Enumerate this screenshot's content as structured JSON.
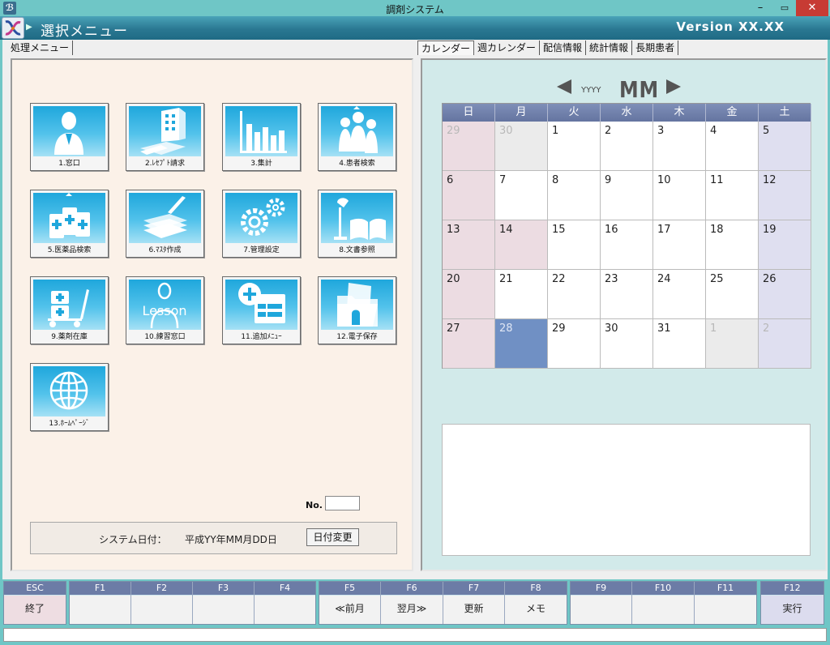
{
  "window": {
    "title": "調剤システム",
    "minimize": "–",
    "maximize": "▭",
    "close": "✕"
  },
  "header": {
    "title": "選択メニュー",
    "version": "Version  XX.XX"
  },
  "left_tabs": [
    {
      "label": "処理メニュー"
    }
  ],
  "right_tabs": [
    {
      "label": "カレンダー"
    },
    {
      "label": "週カレンダー"
    },
    {
      "label": "配信情報"
    },
    {
      "label": "統計情報"
    },
    {
      "label": "長期患者"
    }
  ],
  "menu": [
    {
      "label": "1.窓口",
      "icon": "receptionist-icon"
    },
    {
      "label": "2.ﾚｾﾌﾟﾄ請求",
      "icon": "building-billing-icon"
    },
    {
      "label": "3.集計",
      "icon": "bar-chart-icon"
    },
    {
      "label": "4.患者検索",
      "icon": "people-search-icon"
    },
    {
      "label": "5.医薬品検索",
      "icon": "medicine-search-icon"
    },
    {
      "label": "6.ﾏｽﾀ作成",
      "icon": "documents-pen-icon"
    },
    {
      "label": "7.管理設定",
      "icon": "gears-icon"
    },
    {
      "label": "8.文書参照",
      "icon": "lamp-book-icon"
    },
    {
      "label": "9.薬剤在庫",
      "icon": "medicine-cart-icon"
    },
    {
      "label": "10.練習窓口",
      "icon": "lesson-icon"
    },
    {
      "label": "11.追加ﾒﾆｭｰ",
      "icon": "add-menu-icon"
    },
    {
      "label": "12.電子保存",
      "icon": "folder-icon"
    },
    {
      "label": "13.ﾎｰﾑﾍﾟｰｼﾞ",
      "icon": "globe-icon"
    }
  ],
  "no_field": {
    "label": "No.",
    "value": ""
  },
  "system_date": {
    "label": "システム日付：",
    "value": "平成YY年MM月DD日",
    "button": "日付変更"
  },
  "calendar": {
    "year": "YYYY",
    "month": "MM",
    "weekdays": [
      "日",
      "月",
      "火",
      "水",
      "木",
      "金",
      "土"
    ],
    "weeks": [
      [
        "29",
        "30",
        "1",
        "2",
        "3",
        "4",
        "5"
      ],
      [
        "6",
        "7",
        "8",
        "9",
        "10",
        "11",
        "12"
      ],
      [
        "13",
        "14",
        "15",
        "16",
        "17",
        "18",
        "19"
      ],
      [
        "20",
        "21",
        "22",
        "23",
        "24",
        "25",
        "26"
      ],
      [
        "27",
        "28",
        "29",
        "30",
        "31",
        "1",
        "2"
      ]
    ],
    "other_month_cells": [
      [
        0,
        0
      ],
      [
        0,
        1
      ],
      [
        4,
        5
      ],
      [
        4,
        6
      ]
    ],
    "holiday_cells": [
      [
        2,
        1
      ]
    ],
    "selected_cell": [
      4,
      1
    ],
    "colors": {
      "sunday": "#ecdce2",
      "saturday": "#dfdff0",
      "selected": "#7090c4",
      "header": "#6c7ca6"
    }
  },
  "fkeys": {
    "esc": {
      "code": "ESC",
      "label": "終了"
    },
    "f1": {
      "code": "F1",
      "label": ""
    },
    "f2": {
      "code": "F2",
      "label": ""
    },
    "f3": {
      "code": "F3",
      "label": ""
    },
    "f4": {
      "code": "F4",
      "label": ""
    },
    "f5": {
      "code": "F5",
      "label": "≪前月"
    },
    "f6": {
      "code": "F6",
      "label": "翌月≫"
    },
    "f7": {
      "code": "F7",
      "label": "更新"
    },
    "f8": {
      "code": "F8",
      "label": "メモ"
    },
    "f9": {
      "code": "F9",
      "label": ""
    },
    "f10": {
      "code": "F10",
      "label": ""
    },
    "f11": {
      "code": "F11",
      "label": ""
    },
    "f12": {
      "code": "F12",
      "label": "実行"
    }
  },
  "status_bar": {
    "text": ""
  }
}
